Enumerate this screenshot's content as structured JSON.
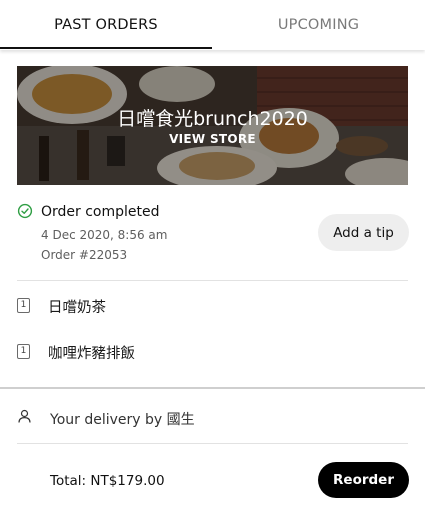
{
  "tabs": {
    "past_orders": "PAST ORDERS",
    "upcoming": "UPCOMING"
  },
  "store": {
    "name": "日嚐食光brunch2020",
    "view_store_label": "VIEW STORE"
  },
  "order": {
    "status": "Order completed",
    "date": "4 Dec 2020, 8:56 am",
    "number": "Order #22053",
    "tip_label": "Add a tip"
  },
  "items": [
    {
      "qty": "1",
      "name": "日嚐奶茶"
    },
    {
      "qty": "1",
      "name": "咖哩炸豬排飯"
    }
  ],
  "delivery": {
    "text": "Your delivery by 國生"
  },
  "footer": {
    "total": "Total: NT$179.00",
    "reorder_label": "Reorder"
  },
  "icons": {
    "status": "check-circle-icon",
    "courier": "person-icon"
  },
  "colors": {
    "status_green": "#2f9e44",
    "primary_button": "#000000",
    "secondary_button": "#eeeeee"
  }
}
